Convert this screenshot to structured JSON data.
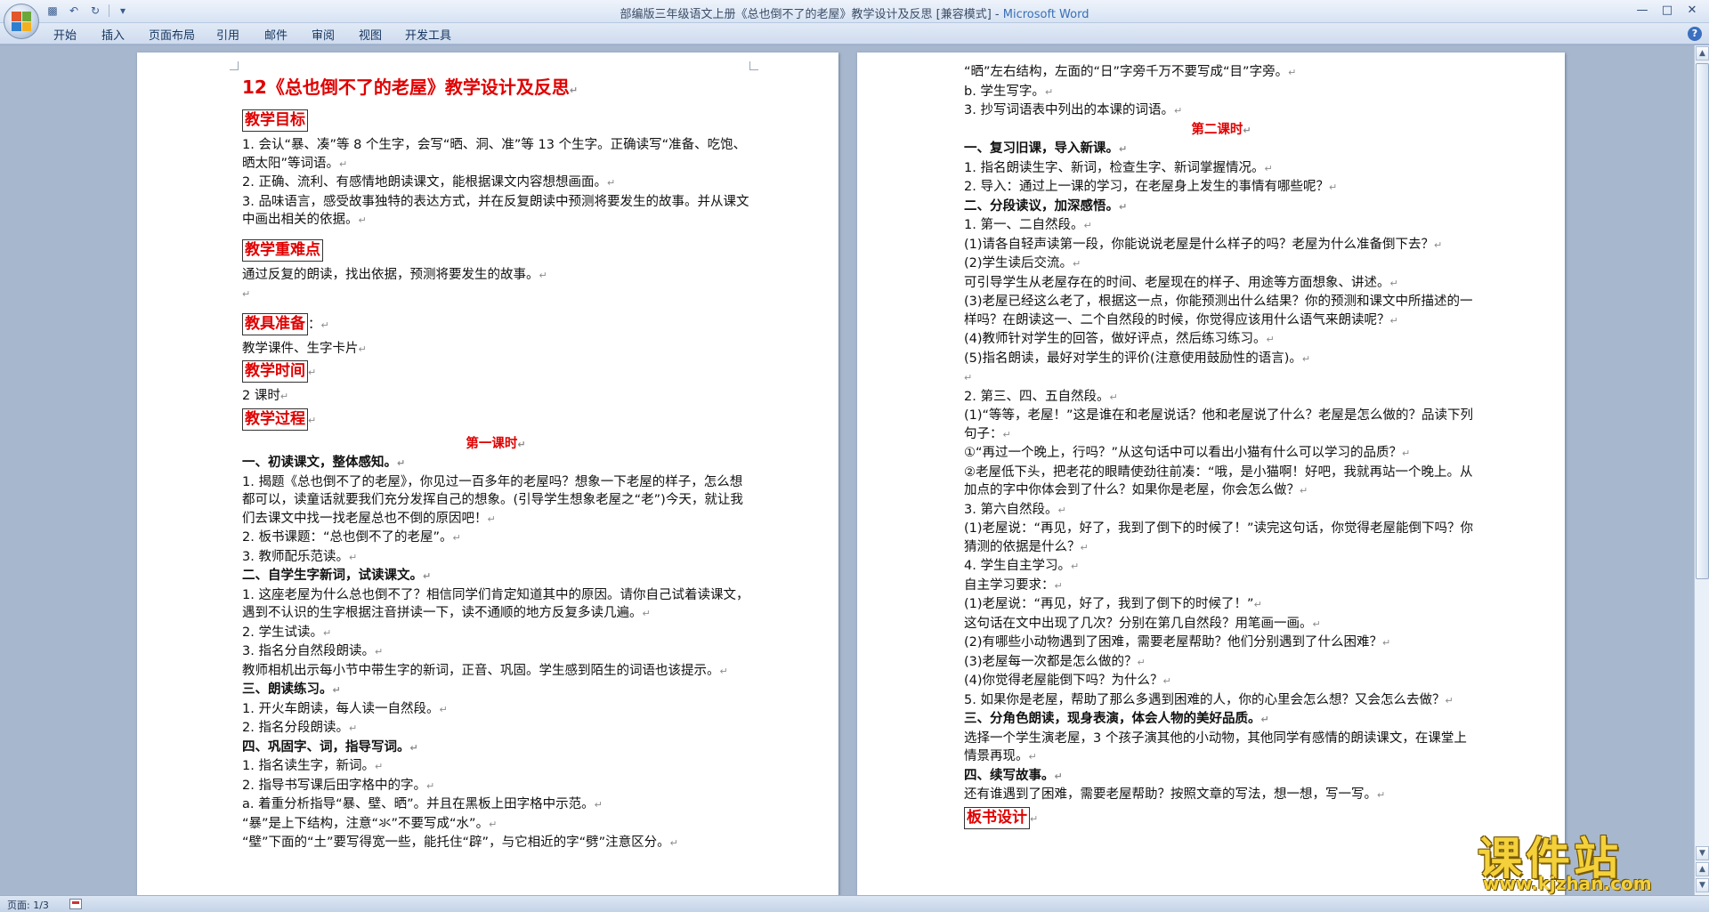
{
  "window": {
    "title": "部编版三年级语文上册《总也倒不了的老屋》教学设计及反思 [兼容模式] - ",
    "app_name": "Microsoft Word"
  },
  "ribbon": {
    "tabs": [
      "开始",
      "插入",
      "页面布局",
      "引用",
      "邮件",
      "审阅",
      "视图",
      "开发工具"
    ]
  },
  "icons": {
    "office_button": "office-logo-icon",
    "save": "save-icon",
    "undo": "undo-icon",
    "redo": "redo-icon",
    "help": "help-icon"
  },
  "status": {
    "page": "页面: 1/3"
  },
  "colors": {
    "heading_red": "#e00000",
    "watermark_yellow": "#f4d13a"
  },
  "watermark": {
    "logo_text": "课件站",
    "url": "www.kjzhan.com"
  },
  "page1": {
    "title": "12《总也倒不了的老屋》教学设计及反思",
    "h_goal": "教学目标",
    "goal1": "1. 会认“暴、凑”等 8 个生字，会写“晒、洞、准”等 13 个生字。正确读写“准备、吃饱、晒太阳”等词语。",
    "goal2": "2. 正确、流利、有感情地朗读课文，能根据课文内容想想画面。",
    "goal3": "3. 品味语言，感受故事独特的表达方式，并在反复朗读中预测将要发生的故事。并从课文中画出相关的依据。",
    "h_key": "教学重难点",
    "key1": "通过反复的朗读，找出依据，预测将要发生的故事。",
    "h_tools": "教具准备",
    "tools_colon": "：",
    "tools1": "教学课件、生字卡片",
    "h_time": "教学时间",
    "time1": "2 课时",
    "h_process": "教学过程",
    "lesson1": "第一课时",
    "s1": "一、初读课文，整体感知。",
    "s1_1": "1. 揭题《总也倒不了的老屋》，你见过一百多年的老屋吗？想象一下老屋的样子，怎么想都可以，读童话就要我们充分发挥自己的想象。(引导学生想象老屋之“老”)今天，就让我们去课文中找一找老屋总也不倒的原因吧！",
    "s1_2": "2. 板书课题：“总也倒不了的老屋”。",
    "s1_3": "3. 教师配乐范读。",
    "s2": "二、自学生字新词，试读课文。",
    "s2_1": "1. 这座老屋为什么总也倒不了？相信同学们肯定知道其中的原因。请你自己试着读课文，遇到不认识的生字根据注音拼读一下，读不通顺的地方反复多读几遍。",
    "s2_2": "2. 学生试读。",
    "s2_3": "3. 指名分自然段朗读。",
    "s2_4": "教师相机出示每小节中带生字的新词，正音、巩固。学生感到陌生的词语也该提示。",
    "s3": "三、朗读练习。",
    "s3_1": "1. 开火车朗读，每人读一自然段。",
    "s3_2": "2. 指名分段朗读。",
    "s4": "四、巩固字、词，指导写词。",
    "s4_1": "1. 指名读生字，新词。",
    "s4_2": "2. 指导书写课后田字格中的字。",
    "s4_3": "a. 着重分析指导“暴、壁、晒”。并且在黑板上田字格中示范。",
    "s4_4": "“暴”是上下结构，注意“氺”不要写成“水”。",
    "s4_5": "“壁”下面的“土”要写得宽一些，能托住“辟”，与它相近的字“劈”注意区分。"
  },
  "page2": {
    "r1": "“晒”左右结构，左面的“日”字旁千万不要写成“目”字旁。",
    "r2": "b. 学生写字。",
    "r3": "3. 抄写词语表中列出的本课的词语。",
    "lesson2": "第二课时",
    "t1": "一、复习旧课，导入新课。",
    "t1_1": "1. 指名朗读生字、新词，检查生字、新词掌握情况。",
    "t1_2": "2. 导入：通过上一课的学习，在老屋身上发生的事情有哪些呢？",
    "t2": "二、分段读议，加深感悟。",
    "t2_1": "1. 第一、二自然段。",
    "t2_2": "(1)请各自轻声读第一段，你能说说老屋是什么样子的吗？老屋为什么准备倒下去？",
    "t2_3": "(2)学生读后交流。",
    "t2_4": "可引导学生从老屋存在的时间、老屋现在的样子、用途等方面想象、讲述。",
    "t2_5": "(3)老屋已经这么老了，根据这一点，你能预测出什么结果？你的预测和课文中所描述的一样吗？在朗读这一、二个自然段的时候，你觉得应该用什么语气来朗读呢？",
    "t2_6": "(4)教师针对学生的回答，做好评点，然后练习练习。",
    "t2_7": "(5)指名朗读，最好对学生的评价(注意使用鼓励性的语言)。",
    "t2_8": "2. 第三、四、五自然段。",
    "t2_9": "(1)“等等，老屋！”这是谁在和老屋说话？他和老屋说了什么？老屋是怎么做的？品读下列句子：",
    "t2_10": "①“再过一个晚上，行吗？”从这句话中可以看出小猫有什么可以学习的品质？",
    "t2_11": "②老屋低下头，把老花的眼睛使劲往前凑：“哦，是小猫啊！好吧，我就再站一个晚上。从加点的字中你体会到了什么？如果你是老屋，你会怎么做？",
    "t2_12": "3. 第六自然段。",
    "t2_13": "(1)老屋说：“再见，好了，我到了倒下的时候了！”读完这句话，你觉得老屋能倒下吗？你猜测的依据是什么？",
    "t2_14": "4. 学生自主学习。",
    "t2_15": "自主学习要求：",
    "t2_16": "(1)老屋说：“再见，好了，我到了倒下的时候了！”",
    "t2_17": "这句话在文中出现了几次？分别在第几自然段？用笔画一画。",
    "t2_18": "(2)有哪些小动物遇到了困难，需要老屋帮助？他们分别遇到了什么困难？",
    "t2_19": "(3)老屋每一次都是怎么做的？",
    "t2_20": "(4)你觉得老屋能倒下吗？为什么？",
    "t2_21": "5. 如果你是老屋，帮助了那么多遇到困难的人，你的心里会怎么想？又会怎么去做？",
    "t3": "三、分角色朗读，现身表演，体会人物的美好品质。",
    "t3_1": "选择一个学生演老屋，3 个孩子演其他的小动物，其他同学有感情的朗读课文，在课堂上情景再现。",
    "t4": "四、续写故事。",
    "t4_1": "还有谁遇到了困难，需要老屋帮助？按照文章的写法，想一想，写一写。",
    "h_board": "板书设计"
  }
}
